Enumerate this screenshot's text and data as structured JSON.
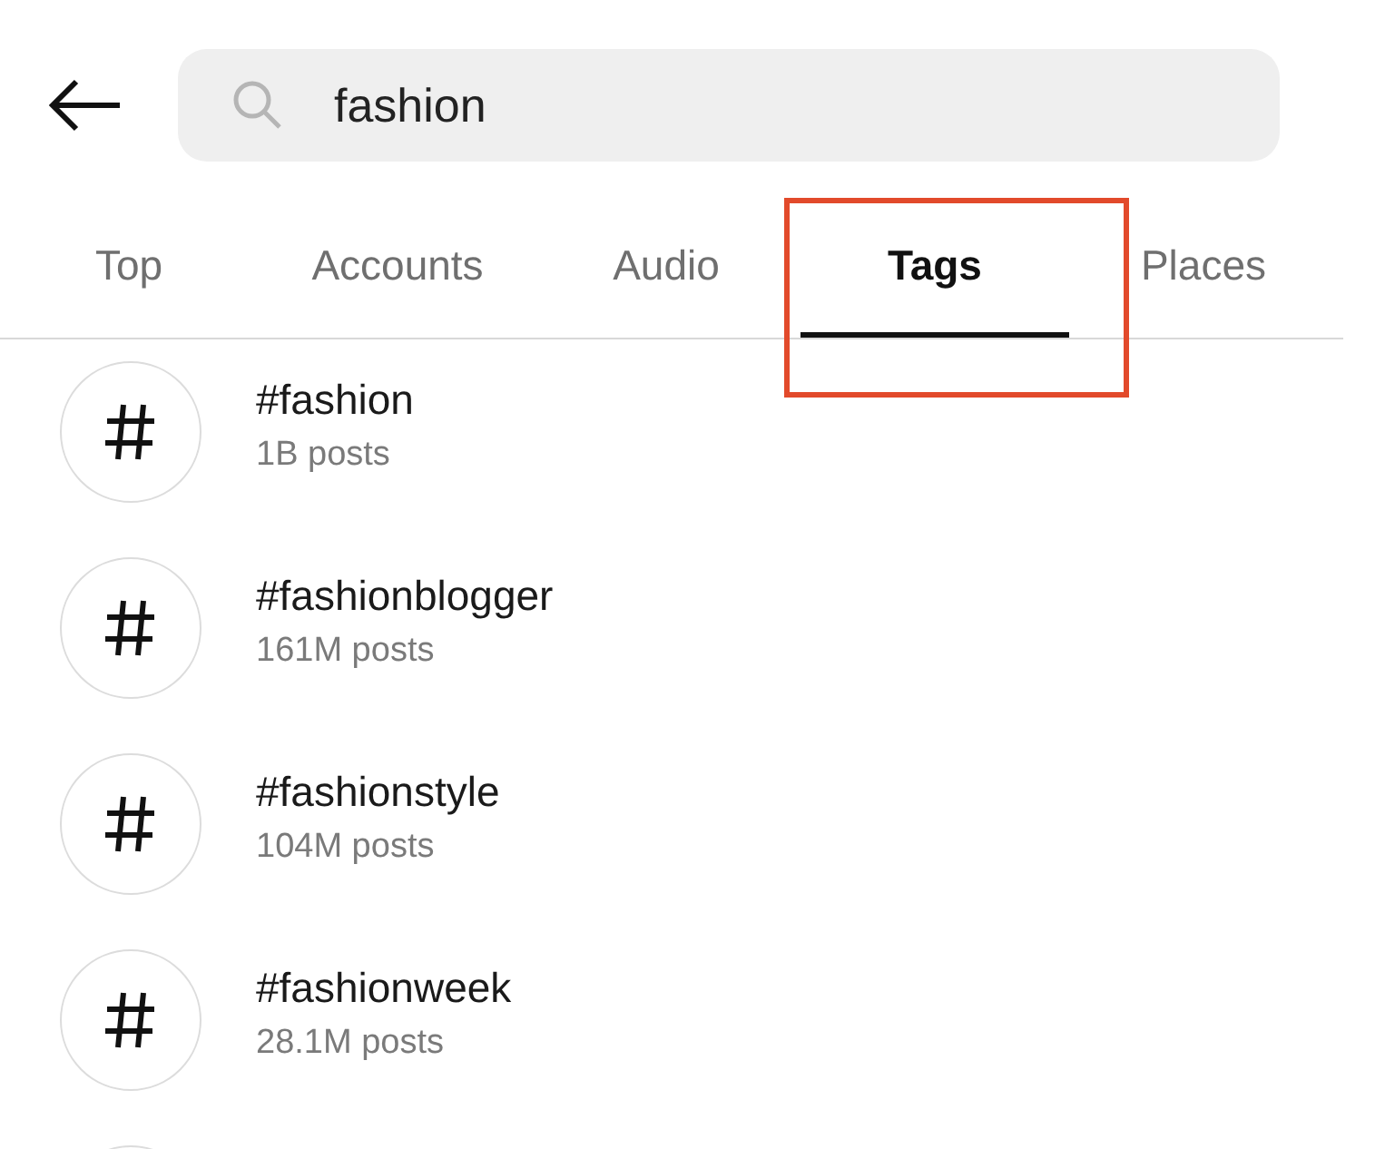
{
  "search": {
    "value": "fashion"
  },
  "tabs": [
    {
      "label": "Top",
      "selected": false
    },
    {
      "label": "Accounts",
      "selected": false
    },
    {
      "label": "Audio",
      "selected": false
    },
    {
      "label": "Tags",
      "selected": true,
      "highlighted": true
    },
    {
      "label": "Places",
      "selected": false,
      "highlighted": false
    }
  ],
  "results": [
    {
      "tag": "#fashion",
      "posts": "1B posts"
    },
    {
      "tag": "#fashionblogger",
      "posts": "161M posts"
    },
    {
      "tag": "#fashionstyle",
      "posts": "104M posts"
    },
    {
      "tag": "#fashionweek",
      "posts": "28.1M posts"
    }
  ],
  "more_below": true
}
